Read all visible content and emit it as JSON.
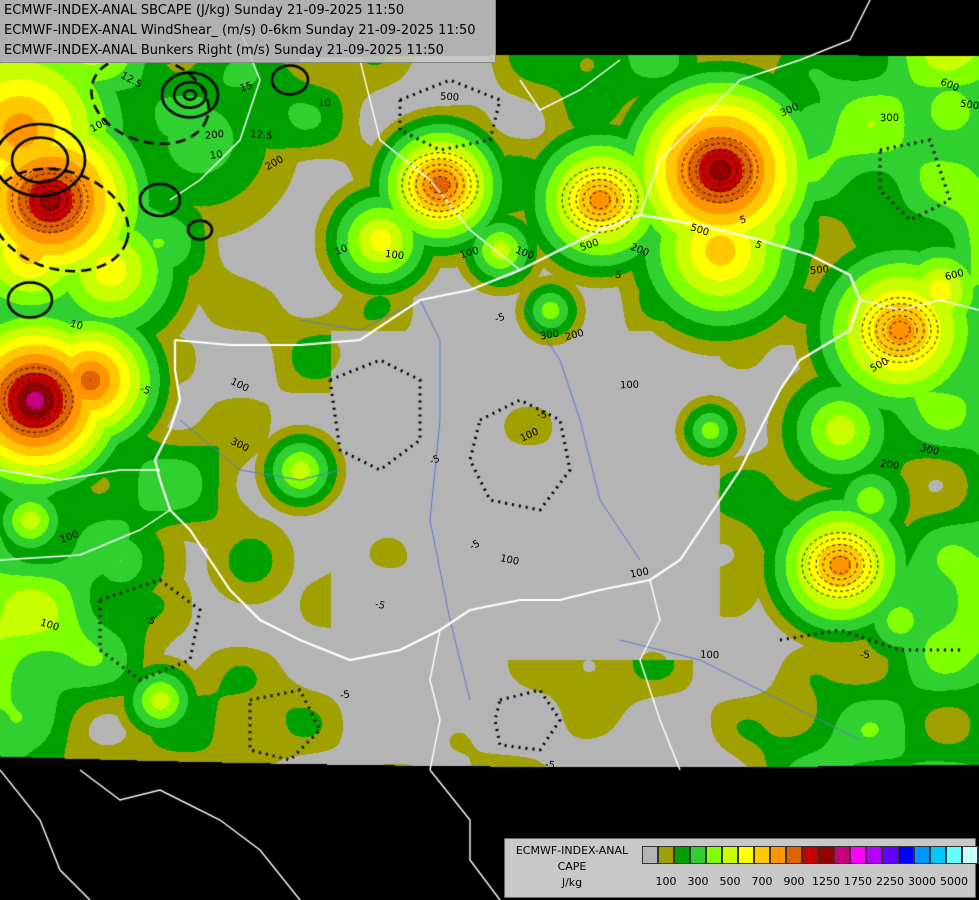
{
  "titles": [
    "ECMWF-INDEX-ANAL SBCAPE (J/kg) Sunday 21-09-2025 11:50",
    "ECMWF-INDEX-ANAL WindShear_ (m/s) 0-6km Sunday 21-09-2025 11:50",
    "ECMWF-INDEX-ANAL Bunkers Right (m/s) Sunday 21-09-2025 11:50"
  ],
  "legend": {
    "model": "ECMWF-INDEX-ANAL",
    "field": "CAPE",
    "unit": "J/kg",
    "colors": [
      "#b4b4b4",
      "#a0a000",
      "#00a000",
      "#30d030",
      "#80ff00",
      "#c8ff00",
      "#ffff00",
      "#ffc800",
      "#ff9600",
      "#e06400",
      "#c80000",
      "#960000",
      "#c8007a",
      "#ff00ff",
      "#b400ff",
      "#6400ff",
      "#0000ff",
      "#0096ff",
      "#00c8ff",
      "#64ffff",
      "#c8ffff",
      "#ffffff"
    ],
    "ticks": [
      {
        "label": "100",
        "at": 1
      },
      {
        "label": "300",
        "at": 3
      },
      {
        "label": "500",
        "at": 5
      },
      {
        "label": "700",
        "at": 7
      },
      {
        "label": "900",
        "at": 9
      },
      {
        "label": "1250",
        "at": 11
      },
      {
        "label": "1750",
        "at": 13
      },
      {
        "label": "2250",
        "at": 15
      },
      {
        "label": "3000",
        "at": 17
      },
      {
        "label": "5000",
        "at": 19
      }
    ]
  },
  "contour_labels": [
    "100",
    "100",
    "100",
    "100",
    "100",
    "100",
    "100",
    "100",
    "100",
    "100",
    "100",
    "100",
    "200",
    "200",
    "200",
    "200",
    "200",
    "300",
    "300",
    "300",
    "300",
    "300",
    "500",
    "500",
    "500",
    "500",
    "500",
    "500",
    "600",
    "600",
    "-5",
    "-5",
    "-5",
    "-5",
    "-5",
    "-5",
    "-5",
    "-5",
    "-5",
    "-5",
    "5",
    "5",
    "5",
    "10",
    "10",
    "10",
    "10",
    "12.5",
    "12.5",
    "15"
  ]
}
